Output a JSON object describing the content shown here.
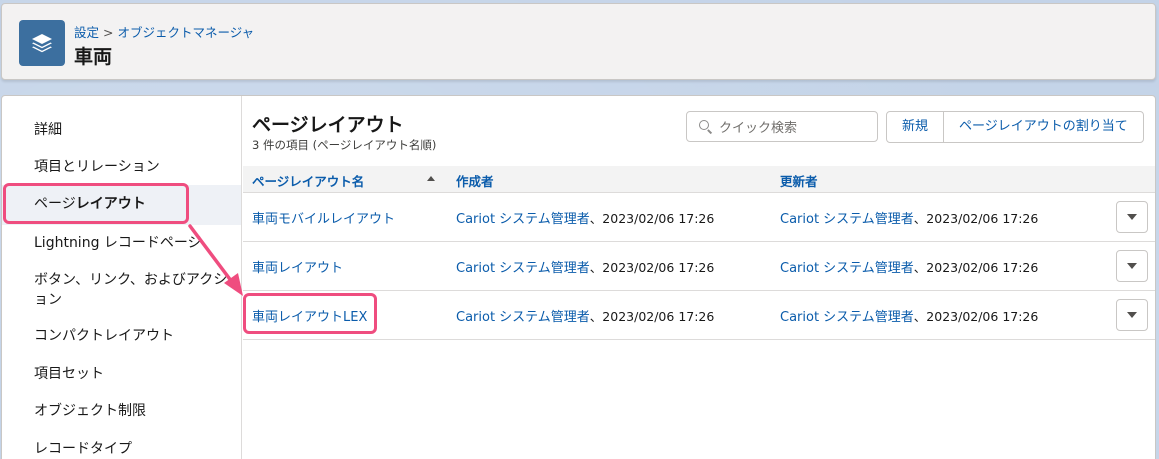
{
  "header": {
    "breadcrumb": [
      "設定",
      ">",
      "オブジェクトマネージャ"
    ],
    "title": "車両",
    "icon": "layers-icon"
  },
  "sidebar": {
    "items": [
      {
        "label": "詳細"
      },
      {
        "label": "項目とリレーション"
      },
      {
        "label_prefix": "ページ",
        "label_bold": "レイアウト",
        "active": true
      },
      {
        "label": "Lightning レコードページ"
      },
      {
        "label_line1": "ボタン、リンク、およびアクシ",
        "label_line2": "ョン"
      },
      {
        "label": "コンパクトレイアウト"
      },
      {
        "label": "項目セット"
      },
      {
        "label": "オブジェクト制限"
      },
      {
        "label": "レコードタイプ"
      }
    ]
  },
  "content": {
    "title": "ページレイアウト",
    "subtitle": "3 件の項目 (ページレイアウト名順)",
    "search_placeholder": "クイック検索",
    "buttons": {
      "new": "新規",
      "assign": "ページレイアウトの割り当て"
    }
  },
  "table": {
    "headers": [
      "ページレイアウト名",
      "作成者",
      "更新者"
    ],
    "rows": [
      {
        "name": "車両モバイルレイアウト",
        "created_by": "Cariot システム管理者",
        "created_date": "、2023/02/06 17:26",
        "modified_by": "Cariot システム管理者",
        "modified_date": "、2023/02/06 17:26"
      },
      {
        "name": "車両レイアウト",
        "created_by": "Cariot システム管理者",
        "created_date": "、2023/02/06 17:26",
        "modified_by": "Cariot システム管理者",
        "modified_date": "、2023/02/06 17:26"
      },
      {
        "name": "車両レイアウトLEX",
        "created_by": "Cariot システム管理者",
        "created_date": "、2023/02/06 17:26",
        "modified_by": "Cariot システム管理者",
        "modified_date": "、2023/02/06 17:26"
      }
    ]
  },
  "colors": {
    "accent": "#ef4d7f",
    "link": "#0b5cab",
    "icon_bg": "#3c6f9f"
  }
}
